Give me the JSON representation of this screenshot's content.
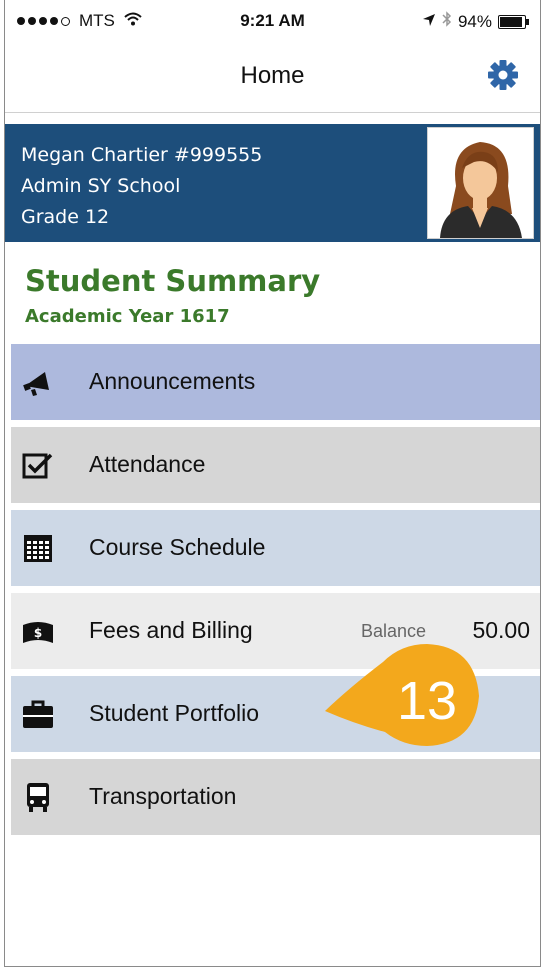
{
  "status_bar": {
    "carrier": "MTS",
    "time": "9:21 AM",
    "battery": "94%"
  },
  "nav": {
    "title": "Home",
    "settings_icon": "gear-icon"
  },
  "profile": {
    "name_line": "Megan Chartier #999555",
    "school": "Admin SY School",
    "grade": "Grade 12"
  },
  "summary": {
    "title": "Student Summary",
    "subtitle": "Academic Year 1617"
  },
  "menu": [
    {
      "label": "Announcements",
      "icon": "megaphone-icon"
    },
    {
      "label": "Attendance",
      "icon": "checkbox-icon"
    },
    {
      "label": "Course Schedule",
      "icon": "calendar-icon"
    },
    {
      "label": "Fees and Billing",
      "icon": "money-icon",
      "balance_label": "Balance",
      "balance_value": "50.00"
    },
    {
      "label": "Student Portfolio",
      "icon": "briefcase-icon"
    },
    {
      "label": "Transportation",
      "icon": "bus-icon"
    }
  ],
  "callout": {
    "number": "13",
    "color": "#f3a81c"
  },
  "colors": {
    "header_bg": "#1d4e7b",
    "summary_green": "#3b7a2b",
    "gear_blue": "#2f66a8"
  }
}
